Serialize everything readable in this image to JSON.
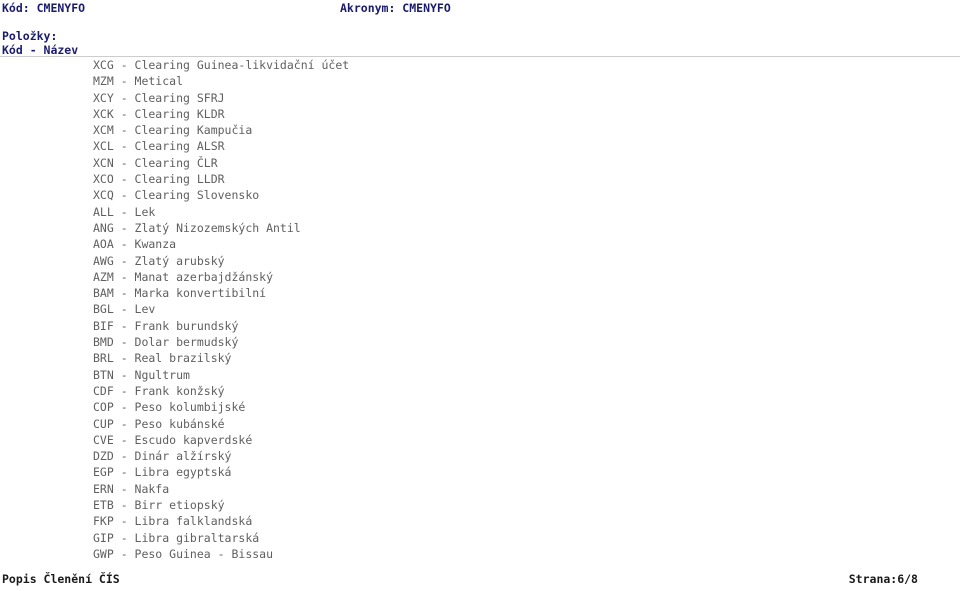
{
  "document": {
    "background_color": "#ffffff",
    "header_color": "#1b1b6e",
    "body_color": "#5f5f5f",
    "footer_color": "#1a1a1a",
    "divider_color": "#cccccc"
  },
  "header": {
    "code_line": "Kód: CMENYFO",
    "acronym_line": "Akronym: CMENYFO",
    "items_label": "Položky:",
    "columns_label": "Kód - Název"
  },
  "items": [
    "XCG - Clearing Guinea-likvidační účet",
    "MZM - Metical",
    "XCY - Clearing SFRJ",
    "XCK - Clearing KLDR",
    "XCM - Clearing Kampučia",
    "XCL - Clearing ALSR",
    "XCN - Clearing ČLR",
    "XCO - Clearing LLDR",
    "XCQ - Clearing Slovensko",
    "ALL - Lek",
    "ANG - Zlatý Nizozemských Antil",
    "AOA - Kwanza",
    "AWG - Zlatý arubský",
    "AZM - Manat azerbajdžánský",
    "BAM - Marka konvertibilní",
    "BGL - Lev",
    "BIF - Frank burundský",
    "BMD - Dolar bermudský",
    "BRL - Real brazilský",
    "BTN - Ngultrum",
    "CDF - Frank konžský",
    "COP - Peso kolumbijské",
    "CUP - Peso kubánské",
    "CVE - Escudo kapverdské",
    "DZD - Dinár alžírský",
    "EGP - Libra egyptská",
    "ERN - Nakfa",
    "ETB - Birr etiopský",
    "FKP - Libra falklandská",
    "GIP - Libra gibraltarská",
    "GWP - Peso Guinea - Bissau"
  ],
  "footer": {
    "title": "Popis Členění ČÍS",
    "page_label": "Strana:6/8"
  }
}
